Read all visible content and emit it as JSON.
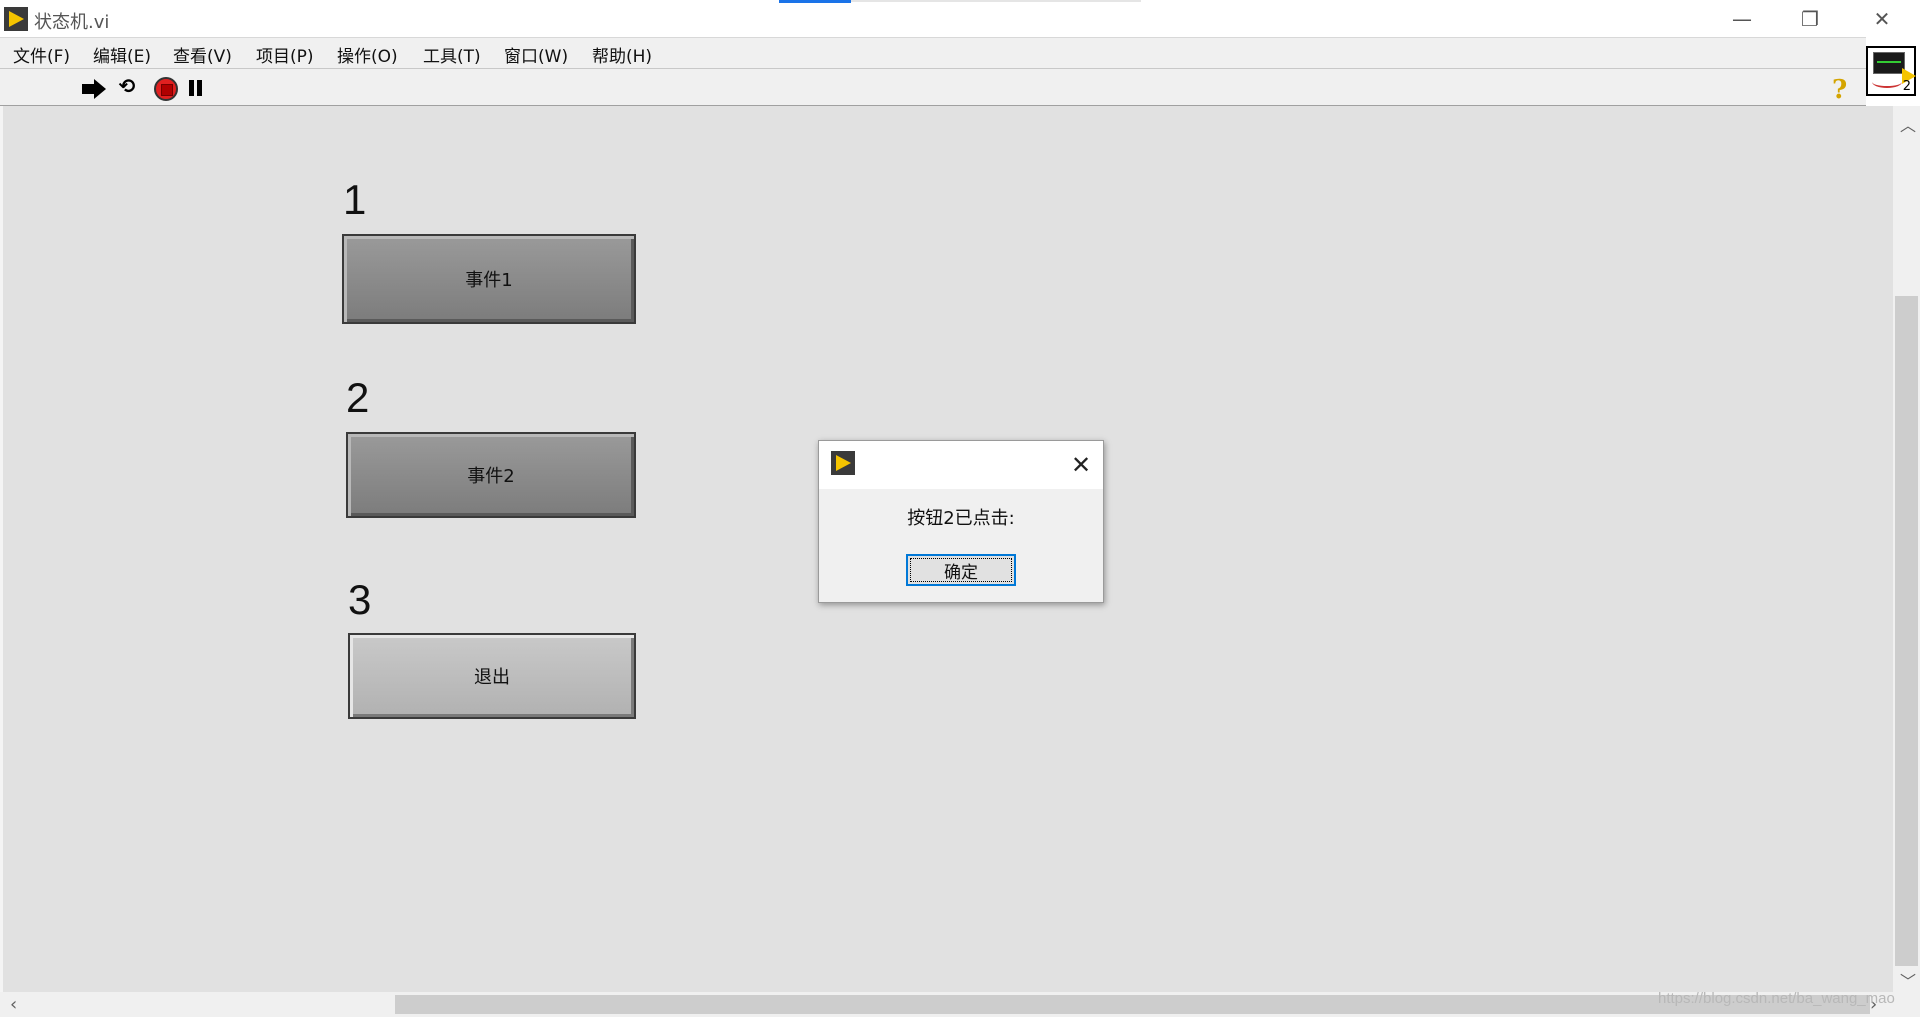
{
  "window": {
    "title": "状态机.vi",
    "minimize_glyph": "—",
    "restore_glyph": "❐",
    "close_glyph": "✕"
  },
  "menu": {
    "items": [
      "文件(F)",
      "编辑(E)",
      "查看(V)",
      "项目(P)",
      "操作(O)",
      "工具(T)",
      "窗口(W)",
      "帮助(H)"
    ]
  },
  "toolbar": {
    "icons": [
      "run-arrow-icon",
      "run-continuously-icon",
      "abort-execution-icon",
      "pause-icon"
    ],
    "run_continuously_glyph": "⟲",
    "help_glyph": "?"
  },
  "vi_icon": {
    "number": "2"
  },
  "controls": [
    {
      "label": "1",
      "button_text": "事件1",
      "style": "dark"
    },
    {
      "label": "2",
      "button_text": "事件2",
      "style": "dark"
    },
    {
      "label": "3",
      "button_text": "退出",
      "style": "light"
    }
  ],
  "dialog": {
    "message": "按钮2已点击:",
    "ok_label": "确定",
    "close_glyph": "✕"
  },
  "scrollbars": {
    "up_glyph": "︿",
    "down_glyph": "﹀",
    "left_glyph": "‹",
    "right_glyph": "›"
  },
  "watermark": "https://blog.csdn.net/ba_wang_mao"
}
